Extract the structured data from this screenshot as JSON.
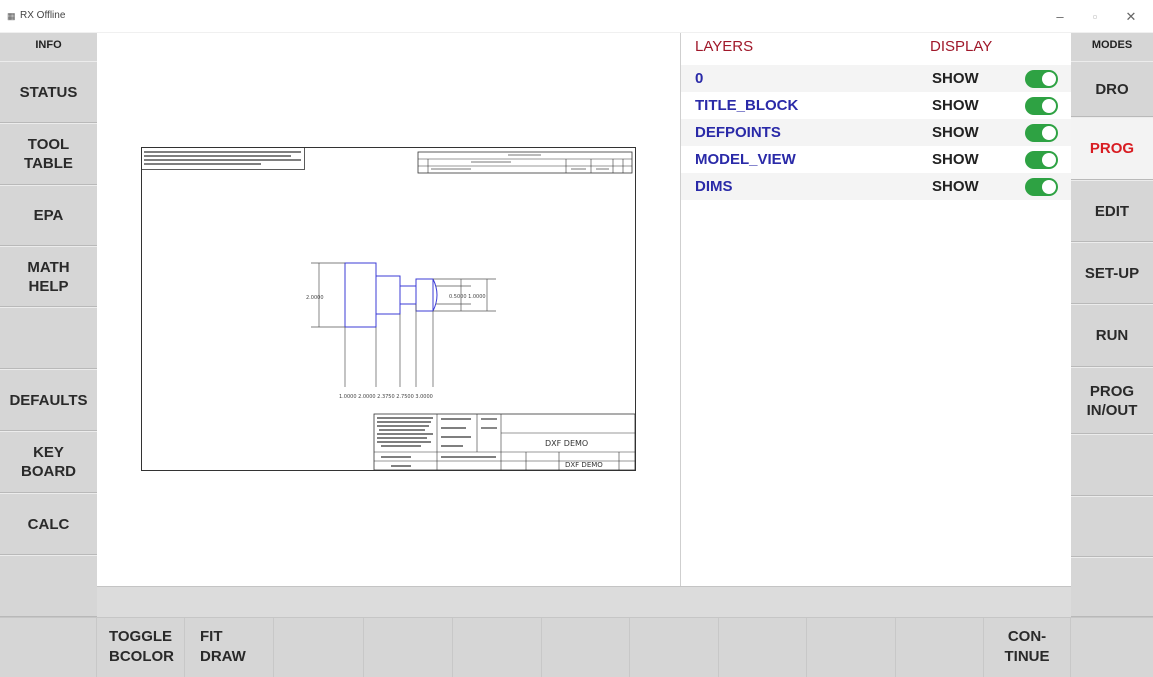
{
  "window": {
    "icon": "app-icon",
    "title": "RX Offline",
    "minimize_glyph": "–",
    "maximize_glyph": "▫",
    "close_glyph": "✕"
  },
  "left_column": {
    "header": "INFO",
    "buttons": [
      "STATUS",
      "TOOL\nTABLE",
      "EPA",
      "MATH\nHELP",
      "",
      "DEFAULTS",
      "KEY\nBOARD",
      "CALC",
      ""
    ]
  },
  "right_column": {
    "header": "MODES",
    "buttons": [
      "DRO",
      "PROG",
      "EDIT",
      "SET-UP",
      "RUN",
      "PROG\nIN/OUT",
      "",
      "",
      ""
    ],
    "active_index": 1
  },
  "layers_panel": {
    "layers_header": "LAYERS",
    "display_header": "DISPLAY",
    "rows": [
      {
        "name": "0",
        "display": "SHOW",
        "on": true
      },
      {
        "name": "TITLE_BLOCK",
        "display": "SHOW",
        "on": true
      },
      {
        "name": "DEFPOINTS",
        "display": "SHOW",
        "on": true
      },
      {
        "name": "MODEL_VIEW",
        "display": "SHOW",
        "on": true
      },
      {
        "name": "DIMS",
        "display": "SHOW",
        "on": true
      }
    ]
  },
  "drawing": {
    "dim_vertical_left": "2.0000",
    "dim_vertical_right": "0.5000  1.0000",
    "dim_bottom": "1.0000   2.0000 2.3750 2.7500 3.0000",
    "title_block_name": "DXF DEMO",
    "drawing_number": "DXF DEMO"
  },
  "bottom_bar": {
    "buttons": [
      "",
      "TOGGLE\nBCOLOR",
      "FIT\nDRAW",
      "",
      "",
      "",
      "",
      "",
      "",
      "",
      "",
      "CON-\nTINUE",
      ""
    ]
  },
  "colors": {
    "panel_gray": "#d6d6d6",
    "active_red": "#d81c22",
    "layer_blue": "#2a2aa8",
    "header_red": "#a0182a",
    "toggle_green": "#2ea243",
    "drawing_blue": "#3b3bd6"
  }
}
